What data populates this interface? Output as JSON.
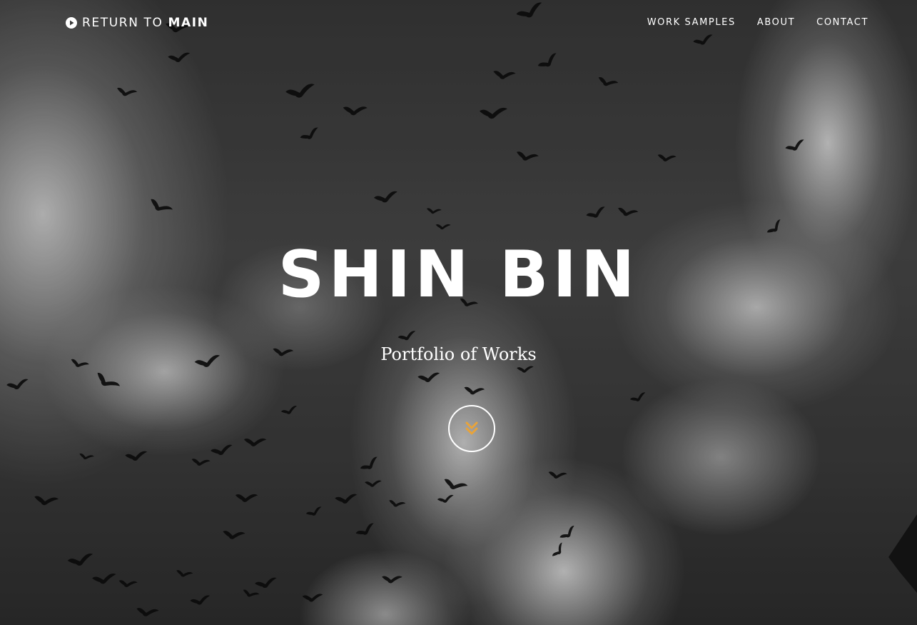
{
  "nav": {
    "brand_prefix": "RETURN TO",
    "brand_bold": "MAIN",
    "brand_icon": "play-circle-icon",
    "links": [
      {
        "label": "WORK SAMPLES"
      },
      {
        "label": "ABOUT"
      },
      {
        "label": "CONTACT"
      }
    ]
  },
  "hero": {
    "title": "SHIN BIN",
    "subtitle": "Portfolio of Works",
    "scroll_icon": "double-chevron-down-icon"
  },
  "colors": {
    "text": "#ffffff",
    "accent": "#e8a33a"
  }
}
